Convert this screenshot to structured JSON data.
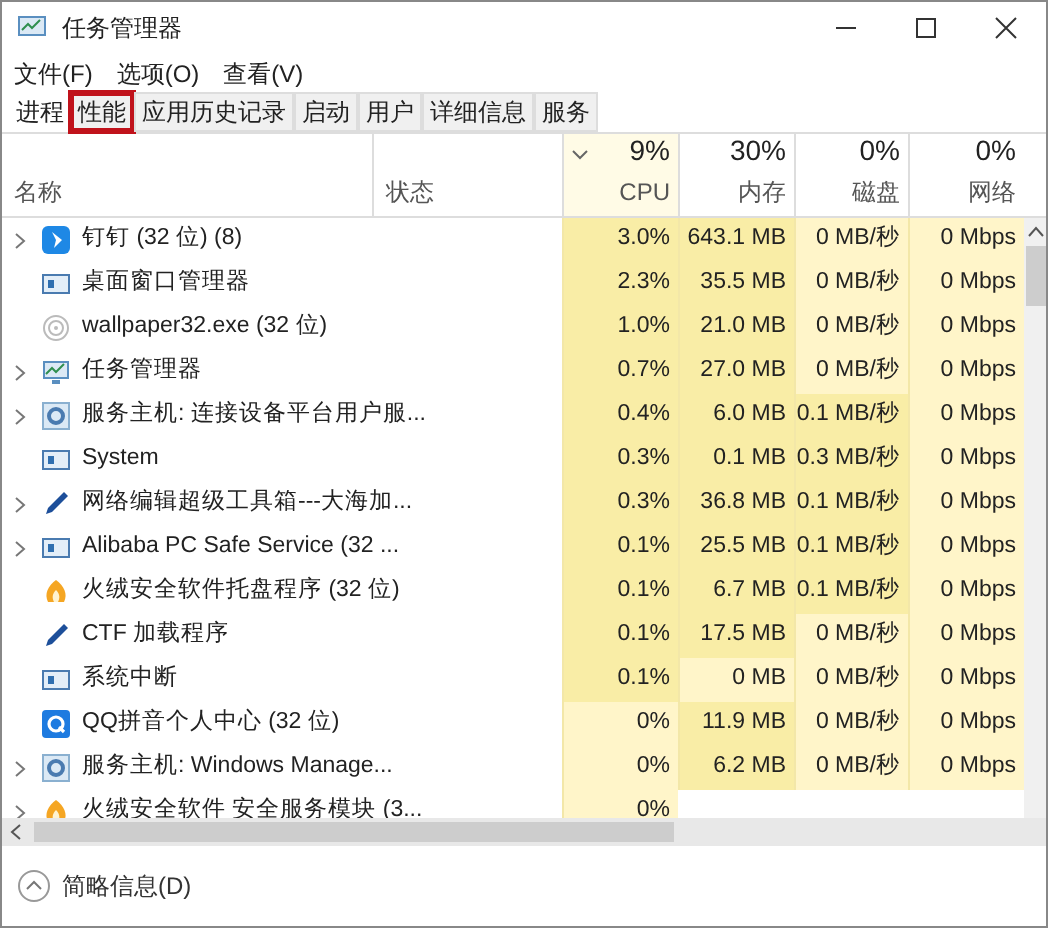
{
  "window": {
    "title": "任务管理器"
  },
  "menu": [
    "文件(F)",
    "选项(O)",
    "查看(V)"
  ],
  "tabs": [
    {
      "label": "进程",
      "selected": true,
      "annotated": false
    },
    {
      "label": "性能",
      "selected": false,
      "annotated": true
    },
    {
      "label": "应用历史记录",
      "selected": false,
      "annotated": false
    },
    {
      "label": "启动",
      "selected": false,
      "annotated": false
    },
    {
      "label": "用户",
      "selected": false,
      "annotated": false
    },
    {
      "label": "详细信息",
      "selected": false,
      "annotated": false
    },
    {
      "label": "服务",
      "selected": false,
      "annotated": false
    }
  ],
  "table": {
    "columns": [
      {
        "label": "名称",
        "sorted": false
      },
      {
        "label": "状态",
        "sorted": false
      },
      {
        "label": "CPU",
        "total": "9%",
        "sorted": true
      },
      {
        "label": "内存",
        "total": "30%",
        "sorted": false
      },
      {
        "label": "磁盘",
        "total": "0%",
        "sorted": false
      },
      {
        "label": "网络",
        "total": "0%",
        "sorted": false
      }
    ],
    "rows": [
      {
        "kind": "app",
        "expandable": true,
        "cells": [
          {
            "text": "钉钉 (32 位) (8)"
          },
          {
            "text": ""
          },
          {
            "text": "3.0%",
            "heavy": true
          },
          {
            "text": "643.1 MB",
            "heavy": true
          },
          {
            "text": "0 MB/秒",
            "heavy": false
          },
          {
            "text": "0 Mbps",
            "heavy": false
          }
        ]
      },
      {
        "kind": "window",
        "expandable": false,
        "cells": [
          {
            "text": "桌面窗口管理器"
          },
          {
            "text": ""
          },
          {
            "text": "2.3%",
            "heavy": true
          },
          {
            "text": "35.5 MB",
            "heavy": true
          },
          {
            "text": "0 MB/秒",
            "heavy": false
          },
          {
            "text": "0 Mbps",
            "heavy": false
          }
        ]
      },
      {
        "kind": "swirl",
        "expandable": false,
        "cells": [
          {
            "text": "wallpaper32.exe (32 位)"
          },
          {
            "text": ""
          },
          {
            "text": "1.0%",
            "heavy": true
          },
          {
            "text": "21.0 MB",
            "heavy": true
          },
          {
            "text": "0 MB/秒",
            "heavy": false
          },
          {
            "text": "0 Mbps",
            "heavy": false
          }
        ]
      },
      {
        "kind": "monitor",
        "expandable": true,
        "cells": [
          {
            "text": "任务管理器"
          },
          {
            "text": ""
          },
          {
            "text": "0.7%",
            "heavy": true
          },
          {
            "text": "27.0 MB",
            "heavy": true
          },
          {
            "text": "0 MB/秒",
            "heavy": false
          },
          {
            "text": "0 Mbps",
            "heavy": false
          }
        ]
      },
      {
        "kind": "gear",
        "expandable": true,
        "cells": [
          {
            "text": "服务主机: 连接设备平台用户服..."
          },
          {
            "text": ""
          },
          {
            "text": "0.4%",
            "heavy": true
          },
          {
            "text": "6.0 MB",
            "heavy": true
          },
          {
            "text": "0.1 MB/秒",
            "heavy": true
          },
          {
            "text": "0 Mbps",
            "heavy": false
          }
        ]
      },
      {
        "kind": "window",
        "expandable": false,
        "cells": [
          {
            "text": "System"
          },
          {
            "text": ""
          },
          {
            "text": "0.3%",
            "heavy": true
          },
          {
            "text": "0.1 MB",
            "heavy": true
          },
          {
            "text": "0.3 MB/秒",
            "heavy": true
          },
          {
            "text": "0 Mbps",
            "heavy": false
          }
        ]
      },
      {
        "kind": "pen",
        "expandable": true,
        "cells": [
          {
            "text": "网络编辑超级工具箱---大海加..."
          },
          {
            "text": ""
          },
          {
            "text": "0.3%",
            "heavy": true
          },
          {
            "text": "36.8 MB",
            "heavy": true
          },
          {
            "text": "0.1 MB/秒",
            "heavy": true
          },
          {
            "text": "0 Mbps",
            "heavy": false
          }
        ]
      },
      {
        "kind": "window",
        "expandable": true,
        "cells": [
          {
            "text": "Alibaba PC Safe Service (32 ..."
          },
          {
            "text": ""
          },
          {
            "text": "0.1%",
            "heavy": true
          },
          {
            "text": "25.5 MB",
            "heavy": true
          },
          {
            "text": "0.1 MB/秒",
            "heavy": true
          },
          {
            "text": "0 Mbps",
            "heavy": false
          }
        ]
      },
      {
        "kind": "flame",
        "expandable": false,
        "cells": [
          {
            "text": "火绒安全软件托盘程序 (32 位)"
          },
          {
            "text": ""
          },
          {
            "text": "0.1%",
            "heavy": true
          },
          {
            "text": "6.7 MB",
            "heavy": true
          },
          {
            "text": "0.1 MB/秒",
            "heavy": true
          },
          {
            "text": "0 Mbps",
            "heavy": false
          }
        ]
      },
      {
        "kind": "pen",
        "expandable": false,
        "cells": [
          {
            "text": "CTF 加载程序"
          },
          {
            "text": ""
          },
          {
            "text": "0.1%",
            "heavy": true
          },
          {
            "text": "17.5 MB",
            "heavy": true
          },
          {
            "text": "0 MB/秒",
            "heavy": false
          },
          {
            "text": "0 Mbps",
            "heavy": false
          }
        ]
      },
      {
        "kind": "window",
        "expandable": false,
        "cells": [
          {
            "text": "系统中断"
          },
          {
            "text": ""
          },
          {
            "text": "0.1%",
            "heavy": true
          },
          {
            "text": "0 MB",
            "heavy": false
          },
          {
            "text": "0 MB/秒",
            "heavy": false
          },
          {
            "text": "0 Mbps",
            "heavy": false
          }
        ]
      },
      {
        "kind": "qq",
        "expandable": false,
        "cells": [
          {
            "text": "QQ拼音个人中心 (32 位)"
          },
          {
            "text": ""
          },
          {
            "text": "0%",
            "heavy": false
          },
          {
            "text": "11.9 MB",
            "heavy": true
          },
          {
            "text": "0 MB/秒",
            "heavy": false
          },
          {
            "text": "0 Mbps",
            "heavy": false
          }
        ]
      },
      {
        "kind": "gear",
        "expandable": true,
        "cells": [
          {
            "text": "服务主机: Windows Manage..."
          },
          {
            "text": ""
          },
          {
            "text": "0%",
            "heavy": false
          },
          {
            "text": "6.2 MB",
            "heavy": true
          },
          {
            "text": "0 MB/秒",
            "heavy": false
          },
          {
            "text": "0 Mbps",
            "heavy": false
          }
        ]
      },
      {
        "kind": "flame",
        "expandable": true,
        "cells": [
          {
            "text": "火绒安全软件 安全服务模块 (3..."
          },
          {
            "text": ""
          },
          {
            "text": "0%",
            "heavy": false
          }
        ]
      }
    ]
  },
  "footer": {
    "label": "简略信息(D)"
  }
}
